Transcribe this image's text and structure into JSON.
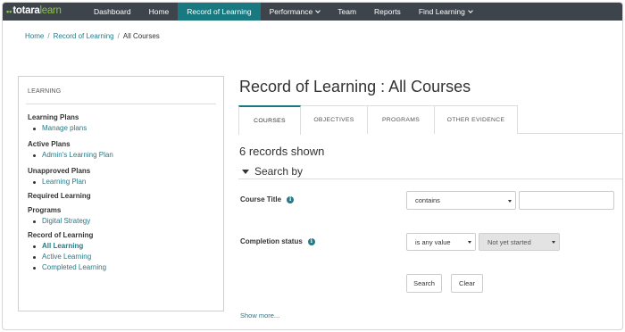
{
  "brand": {
    "mark": "••",
    "word1": "totara",
    "word2": "learn"
  },
  "nav": {
    "dashboard": "Dashboard",
    "home": "Home",
    "record_of_learning": "Record of Learning",
    "performance": "Performance",
    "team": "Team",
    "reports": "Reports",
    "find_learning": "Find Learning"
  },
  "breadcrumb": {
    "home": "Home",
    "sep": "/",
    "record": "Record of Learning",
    "current": "All Courses"
  },
  "sidebar": {
    "heading": "LEARNING",
    "learning_plans": "Learning Plans",
    "manage_plans": "Manage plans",
    "active_plans": "Active Plans",
    "admins_plan": "Admin's Learning Plan",
    "unapproved_plans": "Unapproved Plans",
    "learning_plan": "Learning Plan",
    "required_learning": "Required Learning",
    "programs": "Programs",
    "digital_strategy": "Digital Strategy",
    "record_of_learning": "Record of Learning",
    "all_learning": "All Learning",
    "active_learning": "Active Learning",
    "completed_learning": "Completed Learning"
  },
  "page": {
    "title": "Record of Learning : All Courses",
    "tabs": {
      "courses": "COURSES",
      "objectives": "OBJECTIVES",
      "programs": "PROGRAMS",
      "other_evidence": "OTHER EVIDENCE"
    },
    "records_shown": "6 records shown",
    "search_by": "Search by"
  },
  "filters": {
    "course_title_label": "Course Title",
    "course_title_operator": "contains",
    "course_title_value": "",
    "completion_status_label": "Completion status",
    "completion_status_operator": "is any value",
    "completion_status_value": "Not yet started",
    "info_icon": "i"
  },
  "buttons": {
    "search": "Search",
    "clear": "Clear",
    "show_more": "Show more..."
  },
  "colors": {
    "navbar": "#3d444b",
    "accent": "#187980",
    "link": "#267a88",
    "brand_green": "#8fc53f"
  }
}
